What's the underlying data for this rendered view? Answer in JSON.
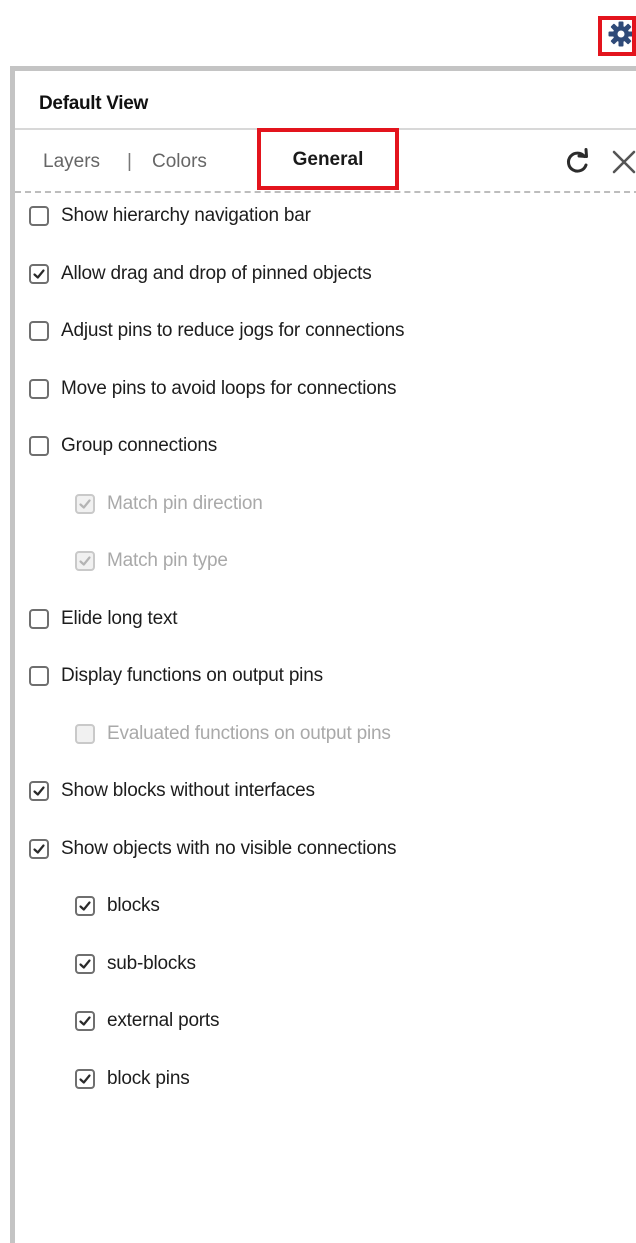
{
  "toolbar": {
    "gear_icon": "gear-icon",
    "gear_highlight_color": "#e3141d",
    "gear_color": "#2f4a78"
  },
  "panel": {
    "title": "Default View",
    "tabs": [
      {
        "label": "Layers",
        "active": false
      },
      {
        "label": "Colors",
        "active": false
      },
      {
        "label": "General",
        "active": true
      }
    ],
    "tab_separator": "|",
    "refresh_icon": "refresh-icon",
    "close_icon": "close-icon",
    "highlight_color": "#e3141d"
  },
  "options": [
    {
      "label": "Show hierarchy navigation bar",
      "checked": false,
      "disabled": false,
      "indent": 0
    },
    {
      "label": "Allow drag and drop of pinned objects",
      "checked": true,
      "disabled": false,
      "indent": 0
    },
    {
      "label": "Adjust pins to reduce jogs for connections",
      "checked": false,
      "disabled": false,
      "indent": 0
    },
    {
      "label": "Move pins to avoid loops for connections",
      "checked": false,
      "disabled": false,
      "indent": 0
    },
    {
      "label": "Group connections",
      "checked": false,
      "disabled": false,
      "indent": 0
    },
    {
      "label": "Match pin direction",
      "checked": true,
      "disabled": true,
      "indent": 1
    },
    {
      "label": "Match pin type",
      "checked": true,
      "disabled": true,
      "indent": 1
    },
    {
      "label": "Elide long text",
      "checked": false,
      "disabled": false,
      "indent": 0
    },
    {
      "label": "Display functions on output pins",
      "checked": false,
      "disabled": false,
      "indent": 0
    },
    {
      "label": "Evaluated functions on output pins",
      "checked": false,
      "disabled": true,
      "indent": 1
    },
    {
      "label": "Show blocks without interfaces",
      "checked": true,
      "disabled": false,
      "indent": 0
    },
    {
      "label": "Show objects with no visible connections",
      "checked": true,
      "disabled": false,
      "indent": 0
    },
    {
      "label": "blocks",
      "checked": true,
      "disabled": false,
      "indent": 1
    },
    {
      "label": "sub-blocks",
      "checked": true,
      "disabled": false,
      "indent": 1
    },
    {
      "label": "external ports",
      "checked": true,
      "disabled": false,
      "indent": 1
    },
    {
      "label": "block pins",
      "checked": true,
      "disabled": false,
      "indent": 1
    }
  ]
}
